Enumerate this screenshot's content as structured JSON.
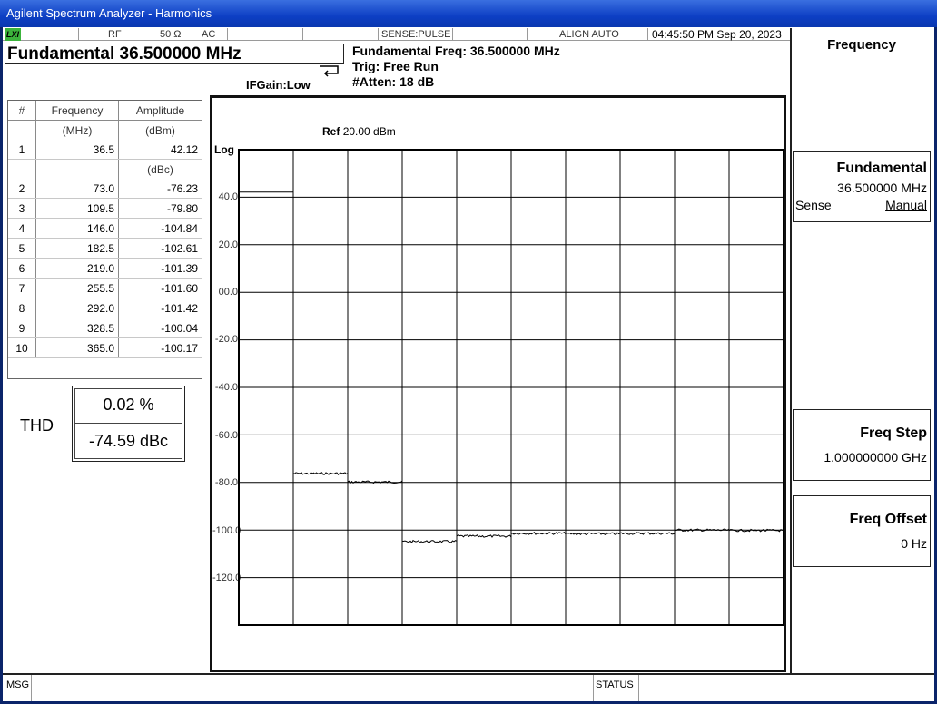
{
  "window": {
    "title": "Agilent Spectrum Analyzer - Harmonics"
  },
  "status_bar": {
    "logo": "LXI",
    "rf": "RF",
    "impedance": "50 Ω",
    "coupling": "AC",
    "sense": "SENSE:PULSE",
    "align": "ALIGN AUTO",
    "datetime": "04:45:50 PM Sep 20, 2023"
  },
  "header": {
    "measurement_title": "Fundamental 36.500000 MHz",
    "fund_freq": "Fundamental Freq: 36.500000 MHz",
    "trig": "Trig: Free Run",
    "atten": "#Atten: 18 dB",
    "ifgain": "IFGain:Low"
  },
  "table": {
    "col_number": "#",
    "col_freq": "Frequency",
    "col_amp": "Amplitude",
    "unit_freq": "(MHz)",
    "unit_amp": "(dBm)",
    "unit_rel": "(dBc)",
    "rows": [
      {
        "n": "1",
        "freq": "36.5",
        "amp": "42.12"
      },
      {
        "n": "2",
        "freq": "73.0",
        "amp": "-76.23"
      },
      {
        "n": "3",
        "freq": "109.5",
        "amp": "-79.80"
      },
      {
        "n": "4",
        "freq": "146.0",
        "amp": "-104.84"
      },
      {
        "n": "5",
        "freq": "182.5",
        "amp": "-102.61"
      },
      {
        "n": "6",
        "freq": "219.0",
        "amp": "-101.39"
      },
      {
        "n": "7",
        "freq": "255.5",
        "amp": "-101.60"
      },
      {
        "n": "8",
        "freq": "292.0",
        "amp": "-101.42"
      },
      {
        "n": "9",
        "freq": "328.5",
        "amp": "-100.04"
      },
      {
        "n": "10",
        "freq": "365.0",
        "amp": "-100.17"
      }
    ]
  },
  "thd": {
    "label": "THD",
    "percent": "0.02 %",
    "dbc": "-74.59 dBc"
  },
  "plot": {
    "ref_label": "Ref",
    "ref_value": "20.00 dBm",
    "scale": "Log",
    "y_labels": [
      "40.0",
      "20.0",
      "00.0",
      "-20.0",
      "-40.0",
      "-60.0",
      "-80.0",
      "-100.0",
      "-120.0"
    ]
  },
  "softkeys": {
    "menu_title": "Frequency",
    "fundamental": {
      "label": "Fundamental",
      "value": "36.500000 MHz",
      "sense": "Sense",
      "mode": "Manual"
    },
    "freq_step": {
      "label": "Freq Step",
      "value": "1.000000000 GHz"
    },
    "freq_offset": {
      "label": "Freq Offset",
      "value": "0 Hz"
    }
  },
  "bottom_bar": {
    "msg": "MSG",
    "status": "STATUS"
  },
  "chart_data": {
    "type": "line",
    "scale": "log",
    "ref_level_dbm": 20.0,
    "ylim": [
      -140,
      60
    ],
    "y_ticks": [
      40,
      20,
      0,
      -20,
      -40,
      -60,
      -80,
      -100,
      -120
    ],
    "grid": true,
    "segments": 10,
    "series": [
      {
        "values": [
          42.12,
          -76.23,
          -79.8,
          -104.84,
          -102.61,
          -101.39,
          -101.6,
          -101.42,
          -100.04,
          -100.17
        ]
      }
    ]
  }
}
